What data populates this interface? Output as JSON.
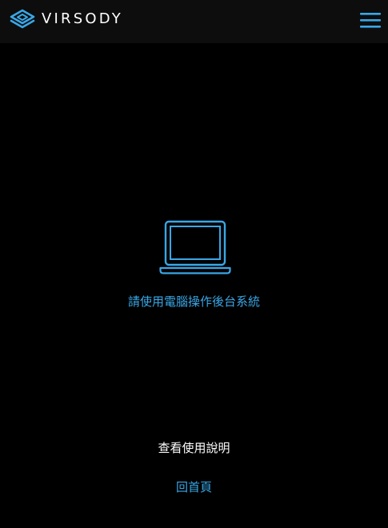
{
  "header": {
    "brand": "VIRSODY",
    "logo_icon": "layers-diamond-icon",
    "menu_icon": "hamburger-menu-icon"
  },
  "main": {
    "device_icon": "laptop-icon",
    "message": "請使用電腦操作後台系統",
    "manual_link": "查看使用說明",
    "home_link": "回首頁"
  },
  "colors": {
    "background": "#000000",
    "header_background": "#0d0d0d",
    "accent": "#39a7e6",
    "text": "#ffffff"
  }
}
